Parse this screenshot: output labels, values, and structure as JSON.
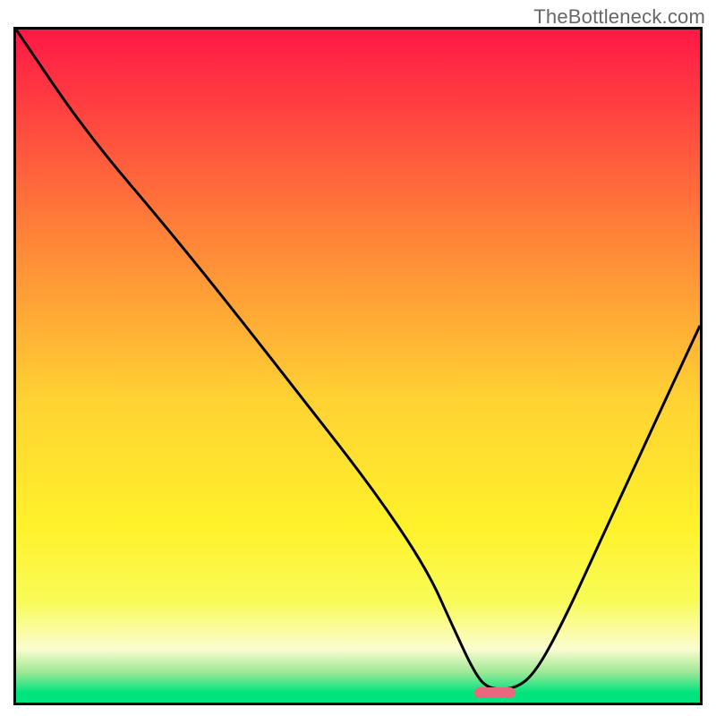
{
  "attribution": "TheBottleneck.com",
  "colors": {
    "gradient_top": "#ff1846",
    "gradient_mid1": "#ff7a39",
    "gradient_mid2": "#ffd233",
    "gradient_mid3": "#fff22b",
    "gradient_mid4": "#f8fb58",
    "gradient_pale": "#fbfdcf",
    "gradient_green1": "#9de896",
    "gradient_green2": "#00e47e",
    "marker": "#e8697e",
    "border": "#000000",
    "curve": "#000000"
  },
  "chart_data": {
    "type": "line",
    "title": "",
    "xlabel": "",
    "ylabel": "",
    "xlim": [
      0,
      100
    ],
    "ylim": [
      0,
      100
    ],
    "series": [
      {
        "name": "bottleneck-curve",
        "x": [
          0,
          10,
          22.5,
          32,
          42,
          52,
          60,
          64,
          67,
          69,
          73,
          76,
          80,
          85,
          92,
          100
        ],
        "values": [
          100,
          85,
          70,
          58,
          45,
          32,
          20,
          11,
          4.5,
          2,
          2,
          4.5,
          12,
          23,
          38.5,
          56
        ]
      }
    ],
    "marker": {
      "x_start": 67,
      "x_end": 73,
      "y": 1.5,
      "meaning": "optimal-zone"
    },
    "gradient_stops_percent": [
      {
        "offset": 0,
        "color": "#ff1846"
      },
      {
        "offset": 28,
        "color": "#ff7a39"
      },
      {
        "offset": 55,
        "color": "#ffd233"
      },
      {
        "offset": 74,
        "color": "#fff22b"
      },
      {
        "offset": 85,
        "color": "#f8fb58"
      },
      {
        "offset": 92,
        "color": "#fbfdcf"
      },
      {
        "offset": 95.5,
        "color": "#9de896"
      },
      {
        "offset": 98.5,
        "color": "#00e47e"
      },
      {
        "offset": 100,
        "color": "#00e47e"
      }
    ]
  }
}
